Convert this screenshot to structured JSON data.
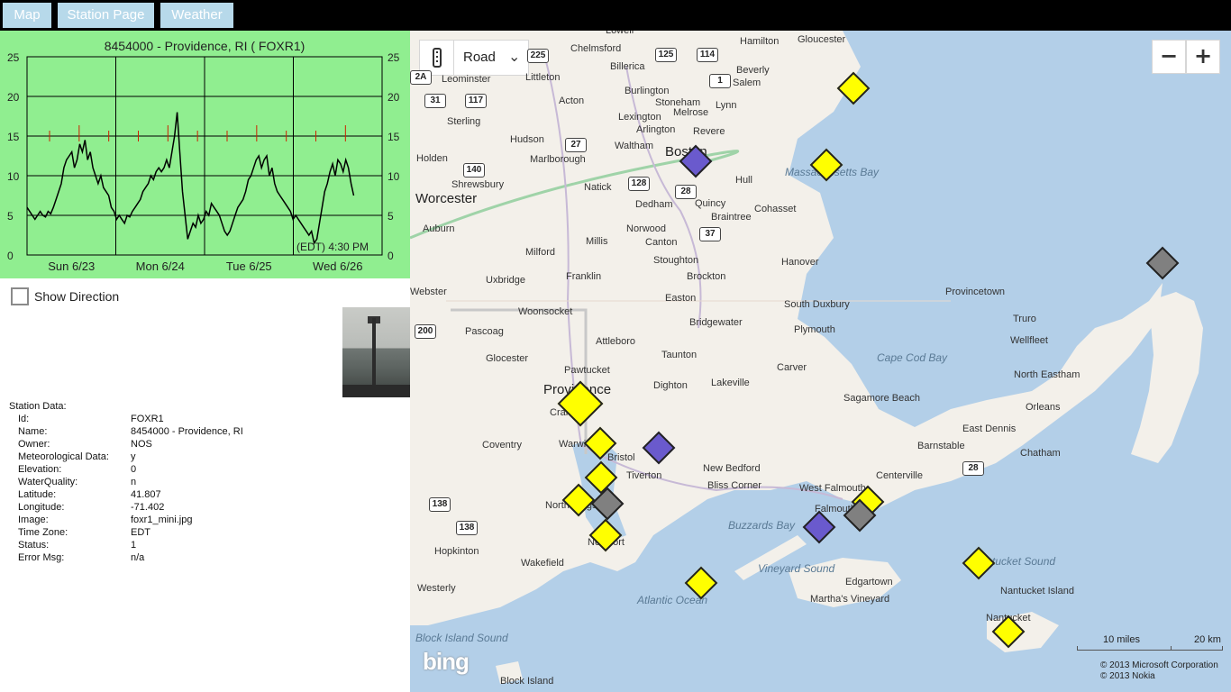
{
  "tabs": [
    {
      "label": "Map"
    },
    {
      "label": "Station Page"
    },
    {
      "label": "Weather"
    }
  ],
  "chart_data": {
    "type": "line",
    "title": "8454000 - Providence, RI ( FOXR1)",
    "yticks": [
      "25",
      "20",
      "15",
      "10",
      "5",
      "0"
    ],
    "ylim": [
      0,
      25
    ],
    "xtick_labels": [
      "Sun  6/23",
      "Mon  6/24",
      "Tue  6/25",
      "Wed  6/26"
    ],
    "timestamp": "(EDT) 4:30 PM",
    "series": [
      {
        "values": [
          6,
          5.5,
          5,
          4.5,
          5,
          5.5,
          5,
          4.8,
          5.5,
          5.2,
          6,
          7,
          8,
          9,
          11,
          12,
          12.5,
          13,
          11,
          12,
          14,
          13,
          14.5,
          12,
          13,
          11,
          10,
          9,
          10,
          8.5,
          8,
          7.5,
          6,
          5.5,
          4.5,
          5,
          4.5,
          4,
          5,
          4.8,
          5.5,
          6,
          6.5,
          7,
          8,
          8.5,
          9,
          10,
          9.5,
          10.5,
          11,
          10.5,
          11,
          12,
          11,
          13,
          15,
          18,
          13,
          8,
          5,
          2,
          3,
          4,
          3.5,
          5,
          4,
          4.5,
          5.5,
          5,
          6.5,
          6,
          5.5,
          5,
          4,
          3,
          2.5,
          3,
          4,
          5,
          6,
          6.5,
          7,
          8,
          9.5,
          10,
          11,
          12,
          12.5,
          11,
          12,
          12.5,
          10,
          11,
          9,
          8,
          7.5,
          7,
          6.5,
          6,
          5.5,
          4.5,
          5,
          4.5,
          4,
          3.5,
          3,
          2.5,
          3,
          1.5,
          2,
          4,
          6,
          8,
          9,
          10.5,
          11.5,
          10,
          12,
          11.5,
          10.5,
          12,
          11,
          9,
          7.5
        ]
      }
    ],
    "ticks_red_y": 15
  },
  "show_direction": {
    "label": "Show Direction",
    "checked": false
  },
  "station": {
    "title": "Station Data:",
    "rows": [
      {
        "key": "Id:",
        "value": "FOXR1"
      },
      {
        "key": "Name:",
        "value": "8454000 - Providence, RI"
      },
      {
        "key": "Owner:",
        "value": "NOS"
      },
      {
        "key": "Meteorological Data:",
        "value": "y"
      },
      {
        "key": "Elevation:",
        "value": "0"
      },
      {
        "key": "WaterQuality:",
        "value": "n"
      },
      {
        "key": "Latitude:",
        "value": "41.807"
      },
      {
        "key": "Longitude:",
        "value": "-71.402"
      },
      {
        "key": "Image:",
        "value": "foxr1_mini.jpg"
      },
      {
        "key": "Time Zone:",
        "value": "EDT"
      },
      {
        "key": "Status:",
        "value": "1"
      },
      {
        "key": "Error Msg:",
        "value": "n/a"
      }
    ]
  },
  "map": {
    "style_selector": {
      "value": "Road"
    },
    "zoom_out_label": "−",
    "zoom_in_label": "+",
    "places": [
      "Lowell",
      "Hamilton",
      "Gloucester",
      "Chelmsford",
      "Billerica",
      "Beverly",
      "Salem",
      "Leominster",
      "Littleton",
      "Burlington",
      "Stoneham",
      "Melrose",
      "Lynn",
      "Acton",
      "Lexington",
      "Arlington",
      "Revere",
      "Sterling",
      "Hudson",
      "Waltham",
      "Boston",
      "Holden",
      "Marlborough",
      "Massachusetts Bay",
      "Shrewsbury",
      "Natick",
      "Hull",
      "Worcester",
      "Dedham",
      "Quincy",
      "Braintree",
      "Cohasset",
      "Auburn",
      "Norwood",
      "Millis",
      "Canton",
      "Milford",
      "Franklin",
      "Stoughton",
      "Hanover",
      "Brockton",
      "Webster",
      "Uxbridge",
      "Easton",
      "Provincetown",
      "South Duxbury",
      "Woonsocket",
      "Truro",
      "Pascoag",
      "Bridgewater",
      "Plymouth",
      "Attleboro",
      "Wellfleet",
      "Cape Cod Bay",
      "Glocester",
      "Taunton",
      "Pawtucket",
      "Carver",
      "North Eastham",
      "Providence",
      "Dighton",
      "Lakeville",
      "Sagamore Beach",
      "Cranston",
      "Orleans",
      "East Dennis",
      "Coventry",
      "Warwick",
      "Barnstable",
      "Chatham",
      "Bristol",
      "Tiverton",
      "New Bedford",
      "Centerville",
      "Bliss Corner",
      "West Falmouth",
      "North Kingstown",
      "Falmouth",
      "Buzzards Bay",
      "Newport",
      "Hopkinton",
      "Nantucket Sound",
      "Wakefield",
      "Vineyard Sound",
      "Edgartown",
      "Westerly",
      "Atlantic Ocean",
      "Martha's Vineyard",
      "Nantucket Island",
      "Nantucket",
      "Block Island Sound",
      "Block Island"
    ],
    "shields": [
      "225",
      "125",
      "114",
      "1",
      "2A",
      "31",
      "117",
      "27",
      "140",
      "128",
      "28",
      "37",
      "200",
      "138",
      "138",
      "28"
    ],
    "scale": {
      "miles": "10 miles",
      "km": "20 km"
    },
    "copyright": [
      "© 2013 Microsoft Corporation",
      "© 2013 Nokia"
    ],
    "logo": "bing"
  }
}
